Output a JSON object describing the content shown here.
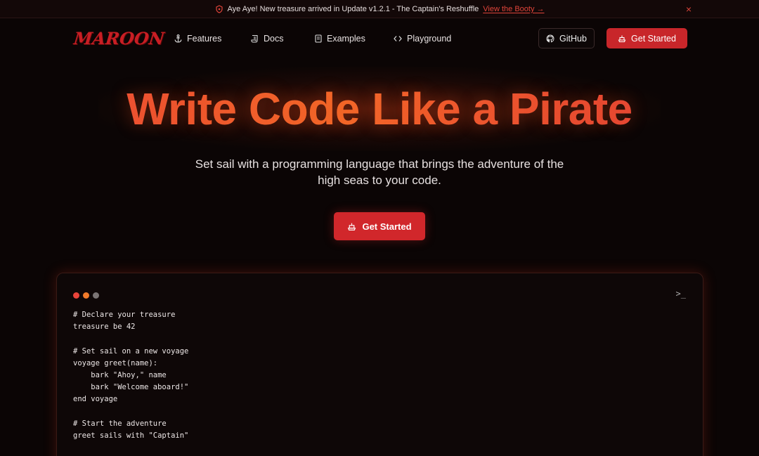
{
  "announcement": {
    "text": "Aye Aye! New treasure arrived in Update v1.2.1 - The Captain's Reshuffle",
    "link": "View the Booty →",
    "close": "×"
  },
  "brand": {
    "logo": "MAROON"
  },
  "nav": {
    "items": [
      {
        "label": "Features",
        "icon": "anchor-icon"
      },
      {
        "label": "Docs",
        "icon": "scroll-icon"
      },
      {
        "label": "Examples",
        "icon": "document-icon"
      },
      {
        "label": "Playground",
        "icon": "code-icon"
      }
    ],
    "github": "GitHub",
    "get_started": "Get Started"
  },
  "hero": {
    "title": "Write Code Like a Pirate",
    "subtitle": "Set sail with a programming language that brings the adventure of the high seas to your code.",
    "cta": "Get Started"
  },
  "code_window": {
    "terminal_glyph": ">_",
    "dot_colors": [
      "#e8443a",
      "#f07a2a",
      "#7a7474"
    ],
    "lines": [
      "# Declare your treasure",
      "treasure be 42",
      "",
      "# Set sail on a new voyage",
      "voyage greet(name):",
      "    bark \"Ahoy,\" name",
      "    bark \"Welcome aboard!\"",
      "end voyage",
      "",
      "# Start the adventure",
      "greet sails with \"Captain\""
    ]
  },
  "colors": {
    "accent": "#c8262a",
    "background": "#0b0505",
    "title_gradient_start": "#e8443a",
    "title_gradient_mid": "#f36a2a"
  }
}
